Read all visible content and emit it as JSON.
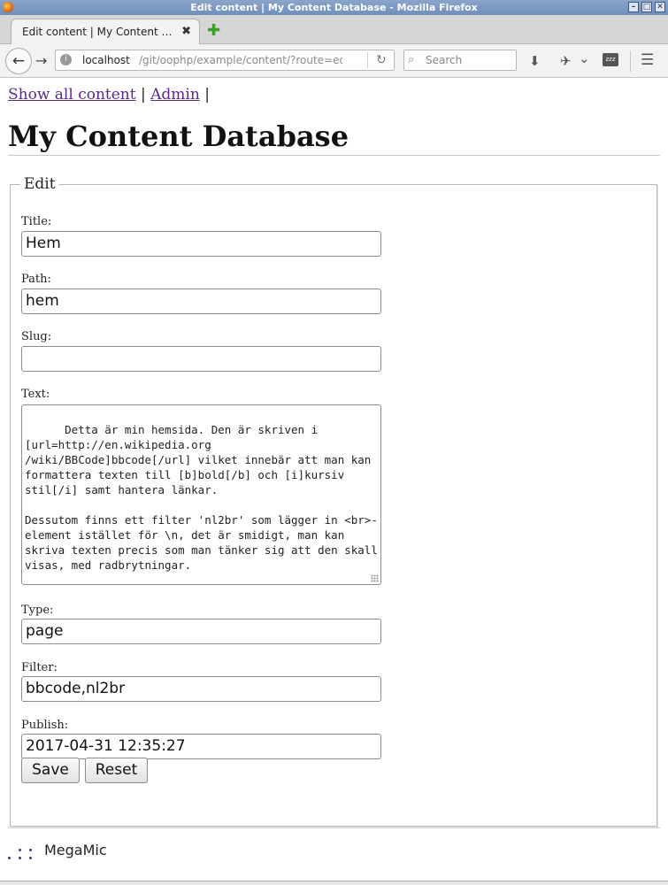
{
  "window": {
    "title": "Edit content | My Content Database - Mozilla Firefox",
    "tab_title": "Edit content | My Content Da...",
    "tab_close": "✖",
    "new_tab": "✚",
    "controls": [
      "–",
      "□",
      "✕"
    ]
  },
  "navbar": {
    "back_icon": "←",
    "forward_icon": "→",
    "url_host": "localhost",
    "url_rest": "/git/oophp/example/content/?route=edit&id",
    "reload_icon": "↻",
    "search_placeholder": "Search",
    "search_icon": "⌕",
    "download_icon": "⬇",
    "addon_icon": "✈",
    "addon_dropdown_icon": "⌄",
    "sleep_icon": "zzz",
    "menu_icon": "☰"
  },
  "page": {
    "nav": {
      "show_all": "Show all content",
      "sep1": "|",
      "admin": "Admin",
      "sep2": "|"
    },
    "site_title": "My Content Database",
    "form": {
      "legend": "Edit",
      "title_label": "Title:",
      "title_value": "Hem",
      "path_label": "Path:",
      "path_value": "hem",
      "slug_label": "Slug:",
      "slug_value": "",
      "text_label": "Text:",
      "text_value": "Detta är min hemsida. Den är skriven i [url=http://en.wikipedia.org\n/wiki/BBCode]bbcode[/url] vilket innebär att man kan formattera texten till [b]bold[/b] och [i]kursiv stil[/i] samt hantera länkar.\n\nDessutom finns ett filter 'nl2br' som lägger in <br>-element istället för \\n, det är smidigt, man kan skriva texten precis som man tänker sig att den skall visas, med radbrytningar.",
      "type_label": "Type:",
      "type_value": "page",
      "filter_label": "Filter:",
      "filter_value": "bbcode,nl2br",
      "publish_label": "Publish:",
      "publish_value": "2017-04-31 12:35:27",
      "save_label": "Save",
      "reset_label": "Reset"
    },
    "footer": {
      "text": "MegaMic"
    }
  }
}
